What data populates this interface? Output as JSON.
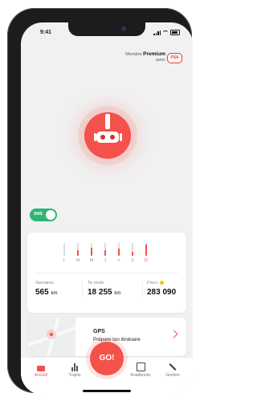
{
  "status_bar": {
    "time": "9:41"
  },
  "header": {
    "membre_prefix": "Membre",
    "membre_level": "Premium",
    "membre_suffix": "avec",
    "partner_logo": "PSA"
  },
  "toggle": {
    "label": "SMS",
    "on": true
  },
  "weekly": {
    "days": [
      {
        "label": "L",
        "level": 0
      },
      {
        "label": "M",
        "level": 0.45
      },
      {
        "label": "M",
        "level": 0.6
      },
      {
        "label": "J",
        "level": 0.45
      },
      {
        "label": "V",
        "level": 0.55
      },
      {
        "label": "S",
        "level": 0.3
      },
      {
        "label": "D",
        "level": 0.9,
        "today": true
      }
    ]
  },
  "stats": {
    "semaine": {
      "label": "Semaine",
      "value": "565",
      "unit": "km"
    },
    "moto": {
      "label": "Ta moto",
      "value": "18 255",
      "unit": "km"
    },
    "flocc": {
      "label": "Flocc",
      "value": "283 090"
    }
  },
  "gps": {
    "title": "GPS",
    "subtitle": "Prépare ton itinéraire"
  },
  "nav": {
    "accueil": "Accueil",
    "trajets": "Trajets",
    "go": "GO!",
    "roadbooks": "Roadbooks",
    "gestion": "Gestion"
  },
  "colors": {
    "accent": "#f4514b",
    "toggle_on": "#2bb673"
  }
}
